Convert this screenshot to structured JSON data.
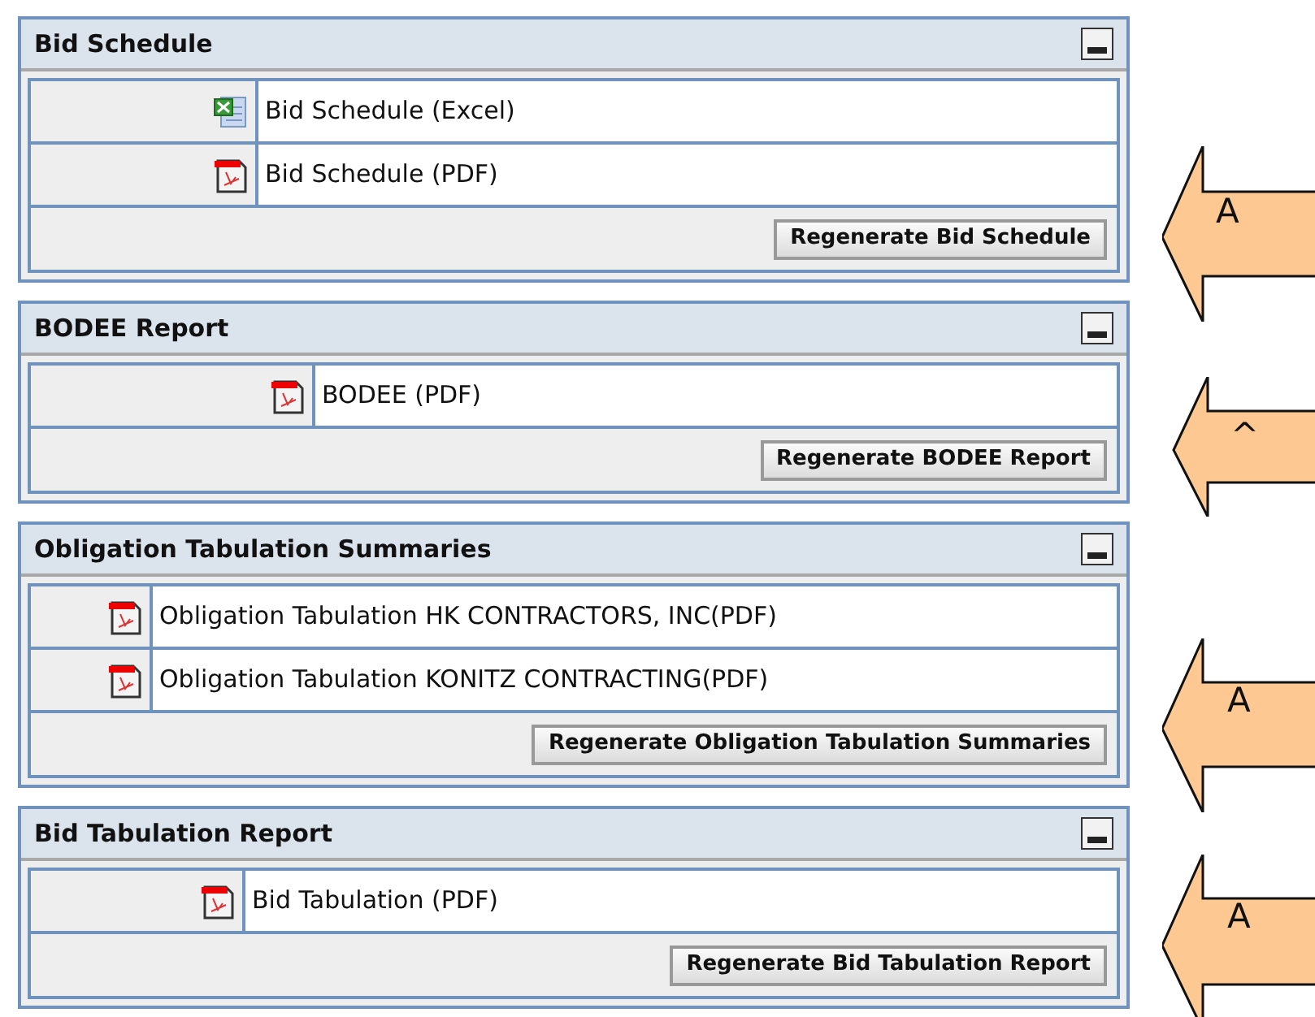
{
  "panels": [
    {
      "title": "Bid Schedule",
      "files": [
        {
          "kind": "excel",
          "label": "Bid Schedule (Excel)"
        },
        {
          "kind": "pdf",
          "label": "Bid Schedule (PDF)"
        }
      ],
      "button": "Regenerate Bid Schedule"
    },
    {
      "title": "BODEE Report",
      "files": [
        {
          "kind": "pdf",
          "label": "BODEE (PDF)"
        }
      ],
      "button": "Regenerate BODEE Report"
    },
    {
      "title": "Obligation Tabulation Summaries",
      "files": [
        {
          "kind": "pdf",
          "label": "Obligation Tabulation HK CONTRACTORS, INC(PDF)"
        },
        {
          "kind": "pdf",
          "label": "Obligation Tabulation KONITZ CONTRACTING(PDF)"
        }
      ],
      "button": "Regenerate Obligation Tabulation Summaries"
    },
    {
      "title": "Bid Tabulation Report",
      "files": [
        {
          "kind": "pdf",
          "label": "Bid Tabulation (PDF)"
        }
      ],
      "button": "Regenerate Bid Tabulation Report"
    }
  ],
  "callouts": [
    {
      "label": "A"
    },
    {
      "label": "^"
    },
    {
      "label": "A"
    },
    {
      "label": "A"
    }
  ]
}
